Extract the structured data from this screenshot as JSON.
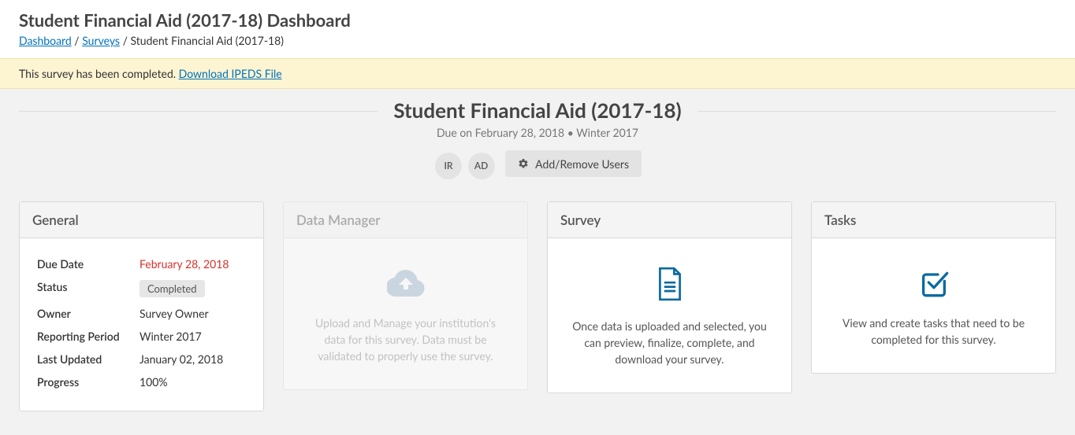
{
  "header": {
    "title": "Student Financial Aid (2017-18) Dashboard",
    "breadcrumb": {
      "dashboard": "Dashboard",
      "surveys": "Surveys",
      "current": "Student Financial Aid (2017-18)"
    }
  },
  "alert": {
    "message": "This survey has been completed.  ",
    "link": "Download IPEDS File"
  },
  "survey": {
    "title": "Student Financial Aid (2017-18)",
    "due_prefix": "Due on ",
    "due_date": "February 28, 2018",
    "separator": "  •  ",
    "period": "Winter 2017"
  },
  "users": {
    "chips": [
      "IR",
      "AD"
    ],
    "button": "Add/Remove Users"
  },
  "cards": {
    "general": {
      "title": "General",
      "rows": {
        "due_date_label": "Due Date",
        "due_date_value": "February 28, 2018",
        "status_label": "Status",
        "status_value": "Completed",
        "owner_label": "Owner",
        "owner_value": "Survey Owner",
        "period_label": "Reporting Period",
        "period_value": "Winter 2017",
        "updated_label": "Last Updated",
        "updated_value": "January 02, 2018",
        "progress_label": "Progress",
        "progress_value": "100%"
      }
    },
    "data_manager": {
      "title": "Data Manager",
      "desc": "Upload and Manage your institution's data for this survey. Data must be validated to properly use the survey."
    },
    "survey_card": {
      "title": "Survey",
      "desc": "Once data is uploaded and selected, you can preview, finalize, complete, and download your survey."
    },
    "tasks": {
      "title": "Tasks",
      "desc": "View and create tasks that need to be completed for this survey."
    }
  }
}
